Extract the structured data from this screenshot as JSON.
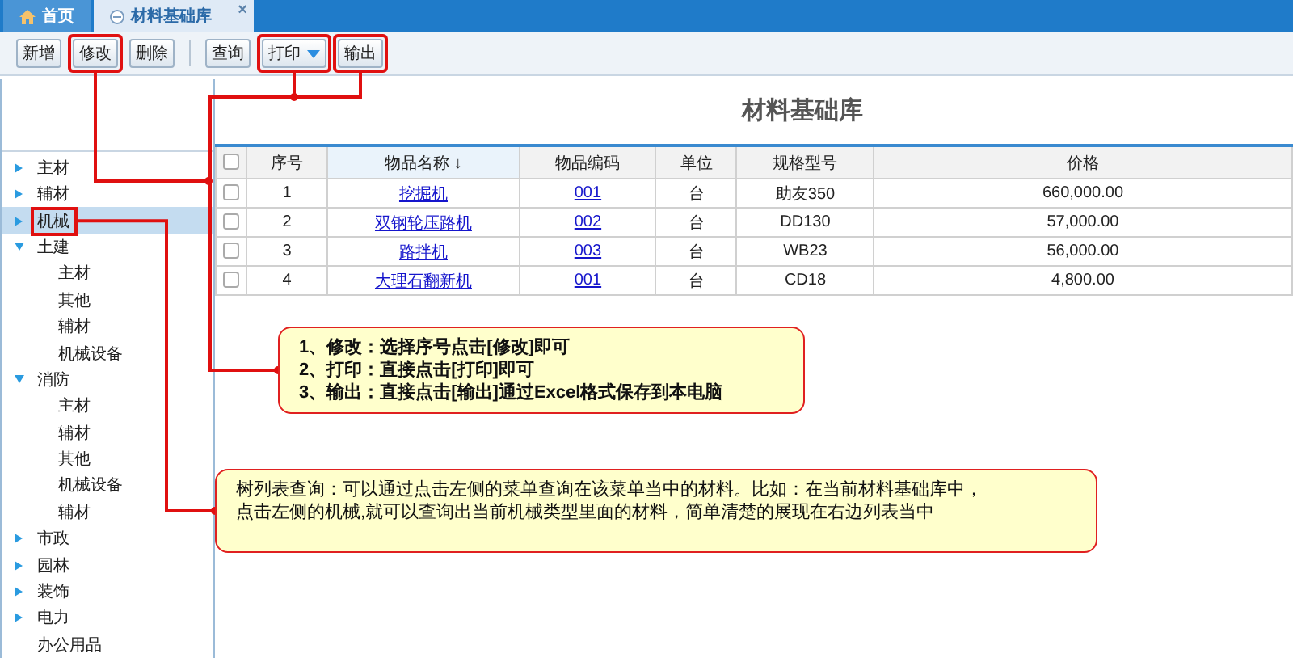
{
  "tabs": [
    {
      "label": "首页",
      "selected": false
    },
    {
      "label": "材料基础库",
      "selected": true,
      "close": "×"
    }
  ],
  "toolbar": {
    "groups": [
      [
        {
          "label": "新增",
          "dropdown": false,
          "highlighted": false
        },
        {
          "label": "修改",
          "dropdown": false,
          "highlighted": true
        },
        {
          "label": "删除",
          "dropdown": false,
          "highlighted": false
        }
      ],
      [
        {
          "label": "查询",
          "dropdown": false,
          "highlighted": false
        },
        {
          "label": "打印",
          "dropdown": true,
          "highlighted": true
        },
        {
          "label": "输出",
          "dropdown": false,
          "highlighted": true
        }
      ]
    ]
  },
  "page_title": "材料基础库",
  "sidebar": {
    "items": [
      {
        "kind": "folder",
        "label": "主材",
        "expanded": false,
        "selected": false,
        "highlighted": false
      },
      {
        "kind": "folder",
        "label": "辅材",
        "expanded": false,
        "selected": false,
        "highlighted": false
      },
      {
        "kind": "folder",
        "label": "机械",
        "expanded": false,
        "selected": true,
        "highlighted": true
      },
      {
        "kind": "folder",
        "label": "土建",
        "expanded": true,
        "selected": false,
        "highlighted": false,
        "children": [
          {
            "label": "主材"
          },
          {
            "label": "其他"
          },
          {
            "label": "辅材"
          },
          {
            "label": "机械设备"
          }
        ]
      },
      {
        "kind": "folder",
        "label": "消防",
        "expanded": true,
        "selected": false,
        "highlighted": false,
        "children": [
          {
            "label": "主材"
          },
          {
            "label": "辅材"
          },
          {
            "label": "其他"
          },
          {
            "label": "机械设备"
          },
          {
            "label": "辅材"
          }
        ]
      },
      {
        "kind": "folder",
        "label": "市政",
        "expanded": false,
        "selected": false,
        "highlighted": false
      },
      {
        "kind": "folder",
        "label": "园林",
        "expanded": false,
        "selected": false,
        "highlighted": false
      },
      {
        "kind": "folder",
        "label": "装饰",
        "expanded": false,
        "selected": false,
        "highlighted": false
      },
      {
        "kind": "folder",
        "label": "电力",
        "expanded": false,
        "selected": false,
        "highlighted": false
      },
      {
        "kind": "leaf",
        "label": "办公用品",
        "selected": false,
        "highlighted": false
      }
    ]
  },
  "table": {
    "all_checked": false,
    "columns": [
      {
        "label": "序号"
      },
      {
        "label": "物品名称",
        "sort_mark": "↓"
      },
      {
        "label": "物品编码"
      },
      {
        "label": "单位"
      },
      {
        "label": "规格型号"
      },
      {
        "label": "价格"
      }
    ],
    "rows": [
      {
        "checked": false,
        "cells": [
          "1",
          "挖掘机",
          "001",
          "台",
          "助友350",
          "660,000.00"
        ]
      },
      {
        "checked": false,
        "cells": [
          "2",
          "双钢轮压路机",
          "002",
          "台",
          "DD130",
          "57,000.00"
        ]
      },
      {
        "checked": false,
        "cells": [
          "3",
          "路拌机",
          "003",
          "台",
          "WB23",
          "56,000.00"
        ]
      },
      {
        "checked": false,
        "cells": [
          "4",
          "大理石翻新机",
          "001",
          "台",
          "CD18",
          "4,800.00"
        ]
      }
    ]
  },
  "callouts": [
    {
      "lines": [
        "1、修改：选择序号点击[修改]即可",
        "2、打印：直接点击[打印]即可",
        "3、输出：直接点击[输出]通过Excel格式保存到本电脑"
      ]
    },
    {
      "lines": [
        "树列表查询：可以通过点击左侧的菜单查询在该菜单当中的材料。比如：在当前材料基础库中，",
        "点击左侧的机械,就可以查询出当前机械类型里面的材料，简单清楚的展现在右边列表当中"
      ]
    }
  ]
}
